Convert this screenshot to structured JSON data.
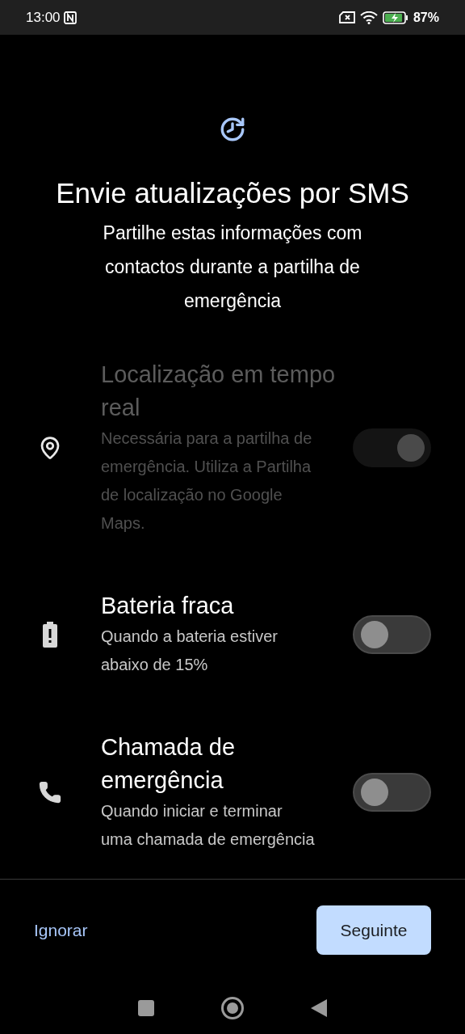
{
  "status_bar": {
    "time": "13:00",
    "battery": "87%"
  },
  "title": "Envie atualizações por SMS",
  "subtitle": "Partilhe estas informações com contactos durante a partilha de emergência",
  "items": [
    {
      "kind": "location",
      "title": "Localização em tempo real",
      "description": "Necessária para a partilha de emergência. Utiliza a Partilha de localização no Google Maps.",
      "checked": true,
      "disabled": true
    },
    {
      "kind": "battery",
      "title": "Bateria fraca",
      "description": "Quando a bateria estiver abaixo de 15%",
      "checked": false,
      "disabled": false
    },
    {
      "kind": "call",
      "title": "Chamada de emergência",
      "description": "Quando iniciar e terminar uma chamada de emergência",
      "checked": false,
      "disabled": false
    }
  ],
  "skip_button": "Ignorar",
  "next_button": "Seguinte"
}
